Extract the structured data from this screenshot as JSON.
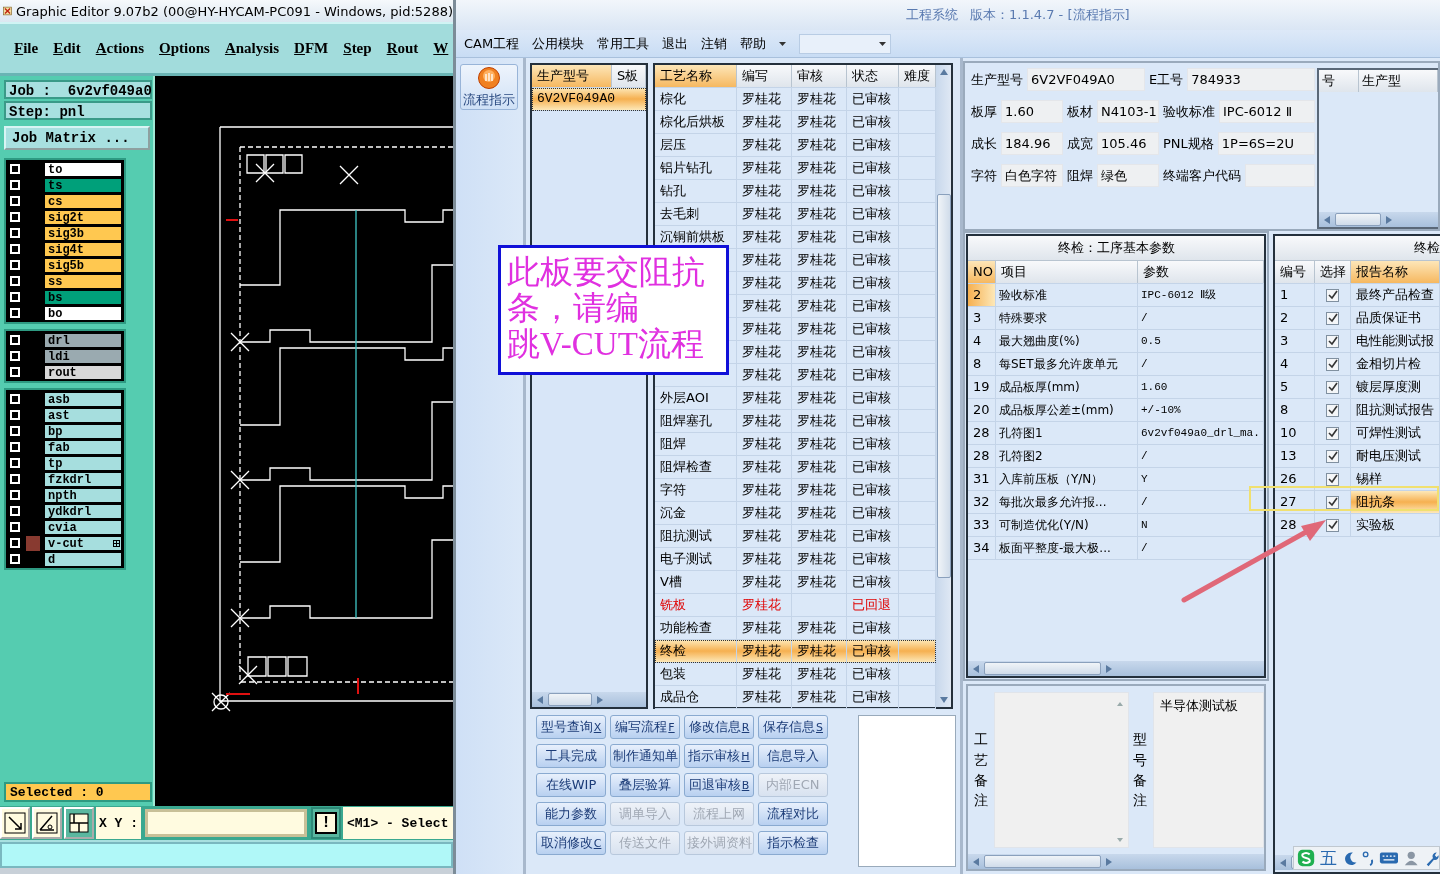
{
  "editor": {
    "title": "Graphic Editor 9.07b2 (00@HY-HYCAM-PC091 - Windows, pid:5288)",
    "menu": [
      "File",
      "Edit",
      "Actions",
      "Options",
      "Analysis",
      "DFM",
      "Step",
      "Rout",
      "W"
    ],
    "job": "Job :  6v2vf049a0",
    "step": "Step: pnl",
    "matrix_button": "Job Matrix ...",
    "layer_groups": [
      [
        {
          "name": "to",
          "color": "#ffffff",
          "checked": false,
          "active": false
        },
        {
          "name": "ts",
          "color": "#00a07a",
          "checked": false,
          "active": false
        },
        {
          "name": "cs",
          "color": "#ffc850",
          "checked": false,
          "active": false
        },
        {
          "name": "sig2t",
          "color": "#ffc850",
          "checked": false,
          "active": false
        },
        {
          "name": "sig3b",
          "color": "#ffc850",
          "checked": false,
          "active": false
        },
        {
          "name": "sig4t",
          "color": "#ffc850",
          "checked": false,
          "active": false
        },
        {
          "name": "sig5b",
          "color": "#ffc850",
          "checked": false,
          "active": false
        },
        {
          "name": "ss",
          "color": "#ffc850",
          "checked": false,
          "active": false
        },
        {
          "name": "bs",
          "color": "#00a07a",
          "checked": false,
          "active": false
        },
        {
          "name": "bo",
          "color": "#ffffff",
          "checked": false,
          "active": false
        }
      ],
      [
        {
          "name": "drl",
          "color": "#9aaab0",
          "checked": false,
          "active": false
        },
        {
          "name": "ldi",
          "color": "#9aaab0",
          "checked": false,
          "active": false
        },
        {
          "name": "rout",
          "color": "#d8d8d8",
          "checked": false,
          "active": false
        }
      ],
      [
        {
          "name": "asb",
          "color": "#a6dede",
          "checked": false,
          "active": false
        },
        {
          "name": "ast",
          "color": "#a6dede",
          "checked": false,
          "active": false
        },
        {
          "name": "bp",
          "color": "#a6dede",
          "checked": false,
          "active": false
        },
        {
          "name": "fab",
          "color": "#a6dede",
          "checked": false,
          "active": false
        },
        {
          "name": "tp",
          "color": "#a6dede",
          "checked": false,
          "active": false
        },
        {
          "name": "fzkdrl",
          "color": "#a6dede",
          "checked": false,
          "active": false
        },
        {
          "name": "npth",
          "color": "#a6dede",
          "checked": false,
          "active": false
        },
        {
          "name": "ydkdrl",
          "color": "#a6dede",
          "checked": false,
          "active": false
        },
        {
          "name": "cvia",
          "color": "#a6dede",
          "checked": false,
          "active": false
        },
        {
          "name": "v-cut",
          "color": "#a6dede",
          "checked": false,
          "active": true
        },
        {
          "name": "d",
          "color": "#a6dede",
          "checked": false,
          "active": false
        }
      ]
    ],
    "selected_count": "Selected : 0",
    "xy_label": "X Y :",
    "alert_button": "!",
    "mouse_hint": "<M1> - Select"
  },
  "engineering": {
    "title": "工程系统",
    "version": "版本：1.1.4.7 - [流程指示]",
    "menu": [
      "CAM工程",
      "公用模块",
      "常用工具",
      "退出",
      "注销",
      "帮助"
    ],
    "sidebar_button": "流程指示",
    "models": {
      "columns": [
        "生产型号",
        "S板"
      ],
      "rows": [
        {
          "model": "6V2VF049A0",
          "selected": true
        }
      ]
    },
    "processes": {
      "columns": [
        "工艺名称",
        "编写",
        "审核",
        "状态",
        "难度"
      ],
      "rows": [
        {
          "name": "棕化",
          "writer": "罗桂花",
          "reviewer": "罗桂花",
          "status": "已审核",
          "returned": false,
          "selected": false
        },
        {
          "name": "棕化后烘板",
          "writer": "罗桂花",
          "reviewer": "罗桂花",
          "status": "已审核",
          "returned": false,
          "selected": false
        },
        {
          "name": "层压",
          "writer": "罗桂花",
          "reviewer": "罗桂花",
          "status": "已审核",
          "returned": false,
          "selected": false
        },
        {
          "name": "铝片钻孔",
          "writer": "罗桂花",
          "reviewer": "罗桂花",
          "status": "已审核",
          "returned": false,
          "selected": false
        },
        {
          "name": "钻孔",
          "writer": "罗桂花",
          "reviewer": "罗桂花",
          "status": "已审核",
          "returned": false,
          "selected": false
        },
        {
          "name": "去毛刺",
          "writer": "罗桂花",
          "reviewer": "罗桂花",
          "status": "已审核",
          "returned": false,
          "selected": false
        },
        {
          "name": "沉铜前烘板",
          "writer": "罗桂花",
          "reviewer": "罗桂花",
          "status": "已审核",
          "returned": false,
          "selected": false
        },
        {
          "writer": "罗桂花",
          "reviewer": "罗桂花",
          "status": "已审核",
          "returned": false,
          "selected": false
        },
        {
          "writer": "罗桂花",
          "reviewer": "罗桂花",
          "status": "已审核",
          "returned": false,
          "selected": false
        },
        {
          "writer": "罗桂花",
          "reviewer": "罗桂花",
          "status": "已审核",
          "returned": false,
          "selected": false
        },
        {
          "writer": "罗桂花",
          "reviewer": "罗桂花",
          "status": "已审核",
          "returned": false,
          "selected": false
        },
        {
          "writer": "罗桂花",
          "reviewer": "罗桂花",
          "status": "已审核",
          "returned": false,
          "selected": false
        },
        {
          "writer": "罗桂花",
          "reviewer": "罗桂花",
          "status": "已审核",
          "returned": false,
          "selected": false
        },
        {
          "name": "外层AOI",
          "writer": "罗桂花",
          "reviewer": "罗桂花",
          "status": "已审核",
          "returned": false,
          "selected": false
        },
        {
          "name": "阻焊塞孔",
          "writer": "罗桂花",
          "reviewer": "罗桂花",
          "status": "已审核",
          "returned": false,
          "selected": false
        },
        {
          "name": "阻焊",
          "writer": "罗桂花",
          "reviewer": "罗桂花",
          "status": "已审核",
          "returned": false,
          "selected": false
        },
        {
          "name": "阻焊检查",
          "writer": "罗桂花",
          "reviewer": "罗桂花",
          "status": "已审核",
          "returned": false,
          "selected": false
        },
        {
          "name": "字符",
          "writer": "罗桂花",
          "reviewer": "罗桂花",
          "status": "已审核",
          "returned": false,
          "selected": false
        },
        {
          "name": "沉金",
          "writer": "罗桂花",
          "reviewer": "罗桂花",
          "status": "已审核",
          "returned": false,
          "selected": false
        },
        {
          "name": "阻抗测试",
          "writer": "罗桂花",
          "reviewer": "罗桂花",
          "status": "已审核",
          "returned": false,
          "selected": false
        },
        {
          "name": "电子测试",
          "writer": "罗桂花",
          "reviewer": "罗桂花",
          "status": "已审核",
          "returned": false,
          "selected": false
        },
        {
          "name": "V槽",
          "writer": "罗桂花",
          "reviewer": "罗桂花",
          "status": "已审核",
          "returned": false,
          "selected": false
        },
        {
          "name": "铣板",
          "writer": "罗桂花",
          "status": "已回退",
          "returned": true,
          "selected": false
        },
        {
          "name": "功能检查",
          "writer": "罗桂花",
          "reviewer": "罗桂花",
          "status": "已审核",
          "returned": false,
          "selected": false
        },
        {
          "name": "终检",
          "writer": "罗桂花",
          "reviewer": "罗桂花",
          "status": "已审核",
          "returned": false,
          "selected": true
        },
        {
          "name": "包装",
          "writer": "罗桂花",
          "reviewer": "罗桂花",
          "status": "已审核",
          "returned": false,
          "selected": false
        },
        {
          "name": "成品仓",
          "writer": "罗桂花",
          "reviewer": "罗桂花",
          "status": "已审核",
          "returned": false,
          "selected": false
        }
      ]
    },
    "buttons": [
      {
        "label": "型号查询",
        "shortcut": "X",
        "disabled": false
      },
      {
        "label": "编写流程",
        "shortcut": "F",
        "disabled": false
      },
      {
        "label": "修改信息",
        "shortcut": "R",
        "disabled": false
      },
      {
        "label": "保存信息",
        "shortcut": "S",
        "disabled": false
      },
      {
        "label": "工具完成",
        "disabled": false
      },
      {
        "label": "制作通知单",
        "disabled": false
      },
      {
        "label": "指示审核",
        "shortcut": "H",
        "disabled": false
      },
      {
        "label": "信息导入",
        "disabled": false
      },
      {
        "label": "在线WIP",
        "disabled": false
      },
      {
        "label": "叠层验算",
        "disabled": false
      },
      {
        "label": "回退审核",
        "shortcut": "B",
        "disabled": false
      },
      {
        "label": "内部ECN",
        "disabled": true
      },
      {
        "label": "能力参数",
        "disabled": false
      },
      {
        "label": "调单导入",
        "disabled": true
      },
      {
        "label": "流程上网",
        "disabled": true
      },
      {
        "label": "流程对比",
        "disabled": false
      },
      {
        "label": "取消修改",
        "shortcut": "C",
        "disabled": false
      },
      {
        "label": "传送文件",
        "disabled": true
      },
      {
        "label": "接外调资料",
        "disabled": true
      },
      {
        "label": "指示检查",
        "disabled": false
      }
    ],
    "info": {
      "top": [
        {
          "label": "生产型号",
          "value": "6V2VF049A0"
        },
        {
          "label": "E工号",
          "value": "784933"
        }
      ],
      "rows": [
        [
          {
            "label": "板厚",
            "value": "1.60"
          },
          {
            "label": "板材",
            "value": "N4103-1"
          },
          {
            "label": "验收标准",
            "value": "IPC-6012 Ⅱ"
          }
        ],
        [
          {
            "label": "成长",
            "value": "184.96"
          },
          {
            "label": "成宽",
            "value": "105.46"
          },
          {
            "label": "PNL规格",
            "value": "1P=6S=2U"
          }
        ],
        [
          {
            "label": "字符",
            "value": "白色字符"
          },
          {
            "label": "阻焊",
            "value": "绿色"
          },
          {
            "label": "终端客户代码"
          }
        ]
      ],
      "mini_grid_columns": [
        "号",
        "生产型"
      ]
    },
    "params": {
      "title": "终检：工序基本参数",
      "columns": [
        "NO",
        "项目",
        "参数"
      ],
      "rows": [
        {
          "no": "2",
          "item": "验收标准",
          "value": "IPC-6012  Ⅱ级",
          "selected": true
        },
        {
          "no": "3",
          "item": "特殊要求",
          "value": "/",
          "selected": false
        },
        {
          "no": "4",
          "item": "最大翘曲度(%)",
          "value": "0.5",
          "selected": false
        },
        {
          "no": "8",
          "item": "每SET最多允许废单元",
          "value": "/",
          "selected": false
        },
        {
          "no": "19",
          "item": "成品板厚(mm)",
          "value": "1.60",
          "selected": false
        },
        {
          "no": "20",
          "item": "成品板厚公差±(mm)",
          "value": "+/-10%",
          "selected": false
        },
        {
          "no": "28",
          "item": "孔符图1",
          "value": "6v2vf049a0_drl_ma.",
          "selected": false
        },
        {
          "no": "28",
          "item": "孔符图2",
          "value": "/",
          "selected": false
        },
        {
          "no": "31",
          "item": "入库前压板（Y/N）",
          "value": "Y",
          "selected": false
        },
        {
          "no": "32",
          "item": "每批次最多允许报...",
          "value": "/",
          "selected": false
        },
        {
          "no": "33",
          "item": "可制造优化(Y/N)",
          "value": "N",
          "selected": false
        },
        {
          "no": "34",
          "item": "板面平整度-最大极...",
          "value": "/",
          "selected": false
        }
      ]
    },
    "reports": {
      "title": "终检",
      "columns": [
        "编号",
        "选择",
        "报告名称"
      ],
      "rows": [
        {
          "no": "1",
          "checked": true,
          "name": "最终产品检查",
          "selected": false
        },
        {
          "no": "2",
          "checked": true,
          "name": "品质保证书",
          "selected": false
        },
        {
          "no": "3",
          "checked": true,
          "name": "电性能测试报",
          "selected": false
        },
        {
          "no": "4",
          "checked": true,
          "name": "金相切片检",
          "selected": false
        },
        {
          "no": "5",
          "checked": true,
          "name": "镀层厚度测",
          "selected": false
        },
        {
          "no": "8",
          "checked": true,
          "name": "阻抗测试报告",
          "selected": false
        },
        {
          "no": "10",
          "checked": true,
          "name": "可焊性测试",
          "selected": false
        },
        {
          "no": "13",
          "checked": true,
          "name": "耐电压测试",
          "selected": false
        },
        {
          "no": "26",
          "checked": true,
          "name": "锡样",
          "selected": false
        },
        {
          "no": "27",
          "checked": true,
          "name": "阻抗条",
          "selected": true
        },
        {
          "no": "28",
          "checked": true,
          "name": "实验板",
          "selected": false
        }
      ]
    },
    "notes": [
      {
        "label": "工艺备注"
      },
      {
        "label": "型号备注",
        "value": "半导体测试板"
      }
    ],
    "ime_mode": "五"
  },
  "note_popup": {
    "lines": [
      "此板要交阻抗",
      "条，请编",
      "跳V-CUT流程"
    ]
  }
}
